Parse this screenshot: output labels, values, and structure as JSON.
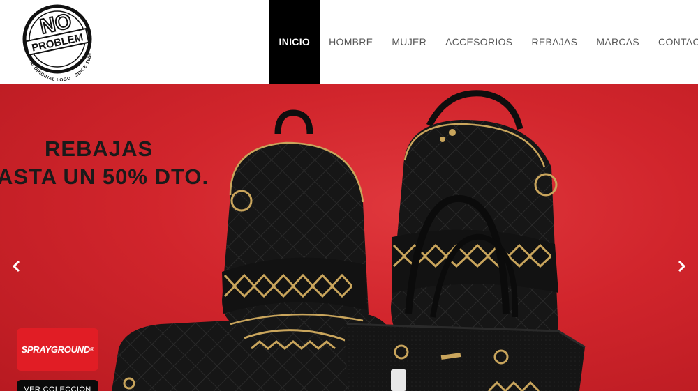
{
  "header": {
    "logo": {
      "name": "no-problem-logo",
      "text_main": "PROBLEM",
      "text_no": "NO",
      "text_arc": "THE ORIGINAL LOGO · SINCE 1989"
    },
    "nav": [
      {
        "label": "INICIO",
        "active": true
      },
      {
        "label": "HOMBRE",
        "active": false
      },
      {
        "label": "MUJER",
        "active": false
      },
      {
        "label": "ACCESORIOS",
        "active": false
      },
      {
        "label": "REBAJAS",
        "active": false
      },
      {
        "label": "MARCAS",
        "active": false
      },
      {
        "label": "CONTACTO",
        "active": false
      }
    ]
  },
  "hero": {
    "promo_line1": "REBAJAS",
    "promo_line2": "ASTA UN 50% DTO.",
    "brand_badge": "SPRAYGROUND",
    "brand_badge_mark": "®",
    "cta_label": "VER COLECCIÓN",
    "prev_icon": "chevron-left-icon",
    "next_icon": "chevron-right-icon"
  },
  "colors": {
    "nav_active_bg": "#000000",
    "hero_red": "#d1252c",
    "badge_red": "#e11d25",
    "bag_black": "#141414",
    "chain_gold": "#c9a55c"
  }
}
